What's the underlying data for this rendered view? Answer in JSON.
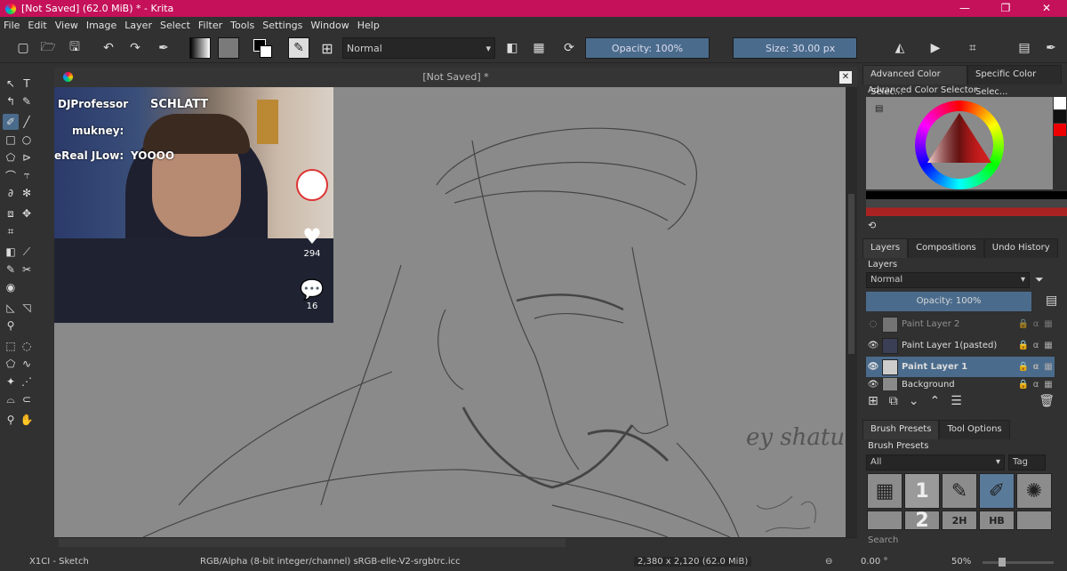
{
  "window": {
    "title": "[Not Saved]  (62.0 MiB)  * - Krita",
    "controls": [
      "—",
      "❐",
      "✕"
    ]
  },
  "menu": [
    "File",
    "Edit",
    "View",
    "Image",
    "Layer",
    "Select",
    "Filter",
    "Tools",
    "Settings",
    "Window",
    "Help"
  ],
  "toolbar": {
    "blend_mode": "Normal",
    "opacity": "Opacity: 100%",
    "size": "Size: 30.00 px"
  },
  "document": {
    "tab_title": "[Not Saved]  *",
    "close": "✕"
  },
  "overlay": {
    "lines": [
      "DJProfessor",
      "mukney:",
      "eReal JLow:",
      "YOOOO"
    ],
    "brand": "SCHLATT",
    "likes": "294",
    "comments": "16"
  },
  "canvas_text": "ey shatu",
  "color_selector": {
    "tabs": [
      "Advanced Color Selec...",
      "Specific Color Selec..."
    ],
    "title": "Advanced Color Selector"
  },
  "layers_panel": {
    "tabs": [
      "Layers",
      "Compositions",
      "Undo History"
    ],
    "title": "Layers",
    "blend_mode": "Normal",
    "opacity": "Opacity:  100%",
    "layers": [
      {
        "name": "Paint Layer 2",
        "visible": false,
        "selected": false
      },
      {
        "name": "Paint Layer 1(pasted)",
        "visible": true,
        "selected": false
      },
      {
        "name": "Paint Layer 1",
        "visible": true,
        "selected": true
      },
      {
        "name": "Background",
        "visible": true,
        "selected": false
      }
    ]
  },
  "brush_panel": {
    "tabs": [
      "Brush Presets",
      "Tool Options"
    ],
    "title": "Brush Presets",
    "filter": "All",
    "tag": "Tag",
    "search_placeholder": "Search"
  },
  "status": {
    "tool": "X1CI - Sketch",
    "color_space": "RGB/Alpha (8-bit integer/channel)  sRGB-elle-V2-srgbtrc.icc",
    "dimensions": "2,380 x 2,120 (62.0 MiB)",
    "rotation": "0.00 °",
    "zoom": "50%"
  },
  "colors": {
    "titlebar": "#c4115a",
    "accent": "#4a6b8c",
    "canvas": "#8a8a8a"
  }
}
